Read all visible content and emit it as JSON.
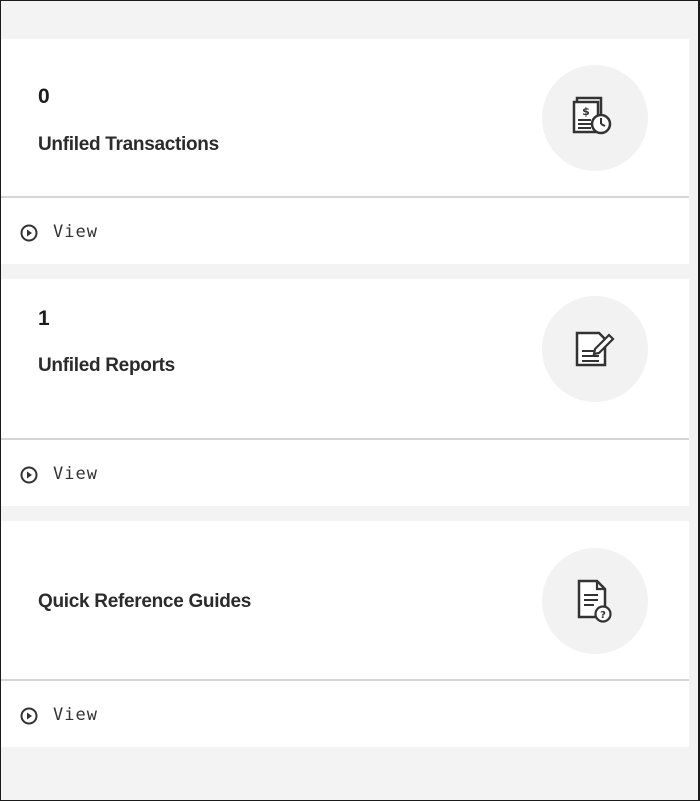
{
  "cards": [
    {
      "count": "0",
      "title": "Unfiled Transactions",
      "icon": "receipt-clock-icon",
      "link_label": "View"
    },
    {
      "count": "1",
      "title": "Unfiled Reports",
      "icon": "report-edit-icon",
      "link_label": "View"
    },
    {
      "count": "",
      "title": "Quick Reference Guides",
      "icon": "document-help-icon",
      "link_label": "View"
    }
  ],
  "colors": {
    "page_background": "#f3f3f3",
    "card_background": "#ffffff",
    "icon_circle": "#f2f2f2",
    "divider": "#d4d4d4",
    "text": "#222222"
  }
}
